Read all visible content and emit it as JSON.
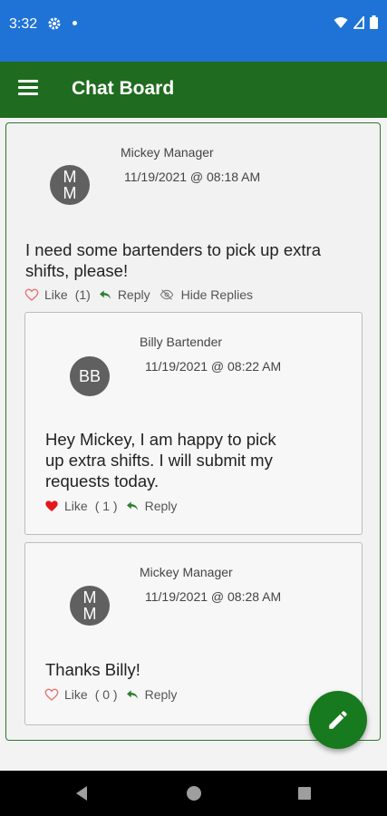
{
  "status_bar": {
    "time": "3:32"
  },
  "app_bar": {
    "title": "Chat Board"
  },
  "post": {
    "avatar_initials_line1": "M",
    "avatar_initials_line2": "M",
    "author": "Mickey Manager",
    "timestamp": "11/19/2021 @ 08:18 AM",
    "message_line1": "I need some bartenders to pick up extra",
    "message_line2": "shifts, please!",
    "like_label": "Like",
    "like_count": "(1)",
    "reply_label": "Reply",
    "hide_replies_label": "Hide Replies"
  },
  "replies": [
    {
      "avatar_initials": "BB",
      "author": "Billy Bartender",
      "timestamp": "11/19/2021 @ 08:22 AM",
      "message_line1": "Hey Mickey, I am happy to pick",
      "message_line2": "up extra shifts.  I will submit my",
      "message_line3": "requests today.",
      "like_label": "Like",
      "like_count": "( 1 )",
      "liked": true,
      "reply_label": "Reply"
    },
    {
      "avatar_initials_line1": "M",
      "avatar_initials_line2": "M",
      "author": "Mickey Manager",
      "timestamp": "11/19/2021 @ 08:28 AM",
      "message_line1": "Thanks Billy!",
      "like_label": "Like",
      "like_count": "( 0 )",
      "liked": false,
      "reply_label": "Reply"
    }
  ],
  "colors": {
    "status_bar": "#1f73d6",
    "app_bar": "#1f6b1f",
    "fab": "#177a1e",
    "reply_green": "#2e7d32",
    "heart_liked": "#e5161c",
    "heart_outline": "#e57373"
  },
  "icons": {
    "menu": "hamburger-icon",
    "fab": "pencil-icon",
    "like": "heart-icon",
    "reply": "reply-arrow-icon",
    "hide_replies": "eye-off-icon"
  }
}
